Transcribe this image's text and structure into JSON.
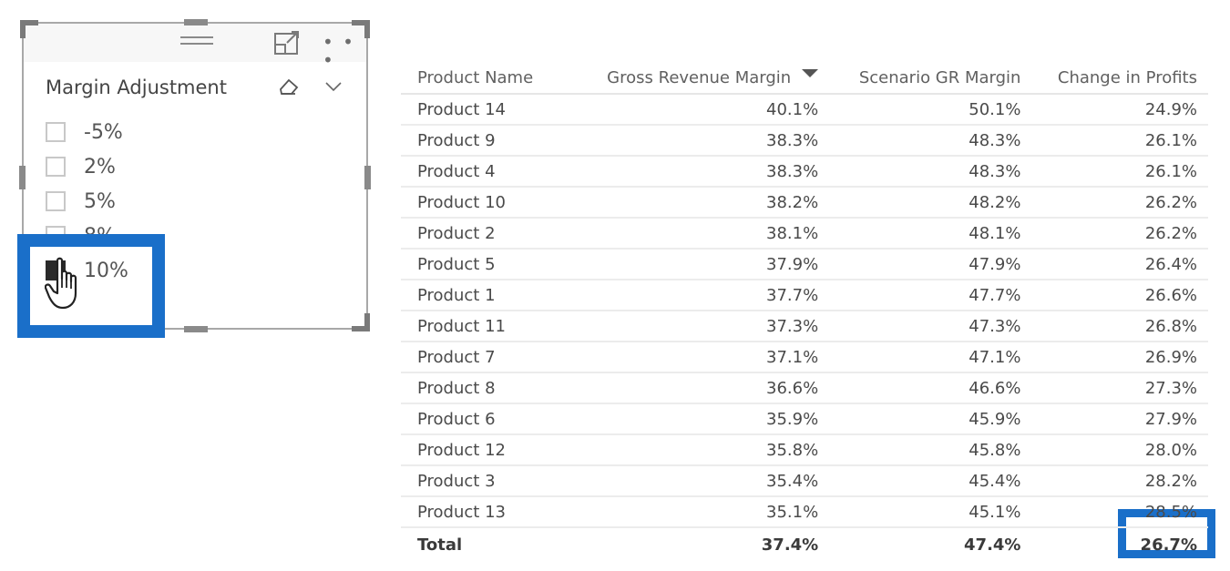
{
  "slicer": {
    "title": "Margin Adjustment",
    "header_icons": [
      "drag-handle-icon",
      "focus-mode-icon",
      "more-options-icon"
    ],
    "more_label": "• • •",
    "options": [
      {
        "label": "-5%",
        "checked": false
      },
      {
        "label": "2%",
        "checked": false
      },
      {
        "label": "5%",
        "checked": false
      },
      {
        "label": "8%",
        "checked": false
      },
      {
        "label": "10%",
        "checked": true
      }
    ]
  },
  "table": {
    "columns": [
      "Product Name",
      "Gross Revenue Margin",
      "Scenario GR Margin",
      "Change in Profits"
    ],
    "sorted_column": "Gross Revenue Margin",
    "sort_direction": "descending",
    "rows": [
      [
        "Product 14",
        "40.1%",
        "50.1%",
        "24.9%"
      ],
      [
        "Product 9",
        "38.3%",
        "48.3%",
        "26.1%"
      ],
      [
        "Product 4",
        "38.3%",
        "48.3%",
        "26.1%"
      ],
      [
        "Product 10",
        "38.2%",
        "48.2%",
        "26.2%"
      ],
      [
        "Product 2",
        "38.1%",
        "48.1%",
        "26.2%"
      ],
      [
        "Product 5",
        "37.9%",
        "47.9%",
        "26.4%"
      ],
      [
        "Product 1",
        "37.7%",
        "47.7%",
        "26.6%"
      ],
      [
        "Product 11",
        "37.3%",
        "47.3%",
        "26.8%"
      ],
      [
        "Product 7",
        "37.1%",
        "47.1%",
        "26.9%"
      ],
      [
        "Product 8",
        "36.6%",
        "46.6%",
        "27.3%"
      ],
      [
        "Product 6",
        "35.9%",
        "45.9%",
        "27.9%"
      ],
      [
        "Product 12",
        "35.8%",
        "45.8%",
        "28.0%"
      ],
      [
        "Product 3",
        "35.4%",
        "45.4%",
        "28.2%"
      ],
      [
        "Product 13",
        "35.1%",
        "45.1%",
        "28.5%"
      ]
    ],
    "total": [
      "Total",
      "37.4%",
      "47.4%",
      "26.7%"
    ]
  },
  "colors": {
    "highlight": "#1a6fc9",
    "checked": "#2a2a2a"
  }
}
